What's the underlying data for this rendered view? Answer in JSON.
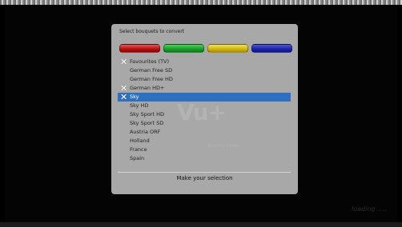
{
  "dialog": {
    "title": "Select bouquets to convert",
    "color_keys": [
      {
        "name": "red",
        "color": "#b20f0f"
      },
      {
        "name": "green",
        "color": "#1b9a2a"
      },
      {
        "name": "yellow",
        "color": "#d1b310"
      },
      {
        "name": "blue",
        "color": "#1b23a8"
      }
    ],
    "bouquets": [
      {
        "label": "Favourites (TV)",
        "checked": true,
        "selected": false
      },
      {
        "label": "German Free SD",
        "checked": false,
        "selected": false
      },
      {
        "label": "German Free HD",
        "checked": false,
        "selected": false
      },
      {
        "label": "German HD+",
        "checked": true,
        "selected": false
      },
      {
        "label": "Sky",
        "checked": true,
        "selected": true
      },
      {
        "label": "Sky HD",
        "checked": false,
        "selected": false
      },
      {
        "label": "Sky Sport HD",
        "checked": false,
        "selected": false
      },
      {
        "label": "Sky Sport SD",
        "checked": false,
        "selected": false
      },
      {
        "label": "Austria ORF",
        "checked": false,
        "selected": false
      },
      {
        "label": "Holland",
        "checked": false,
        "selected": false
      },
      {
        "label": "France",
        "checked": false,
        "selected": false
      },
      {
        "label": "Spain",
        "checked": false,
        "selected": false
      }
    ],
    "check_mark": "✕",
    "footer": "Make your selection"
  },
  "watermark": {
    "logo": "Vu+",
    "tagline": "Vu+ Plus Media"
  },
  "status": {
    "loading": "loading ....."
  },
  "colors": {
    "selection": "#2e6fbf",
    "dialog_bg": "#a8a8a8"
  }
}
